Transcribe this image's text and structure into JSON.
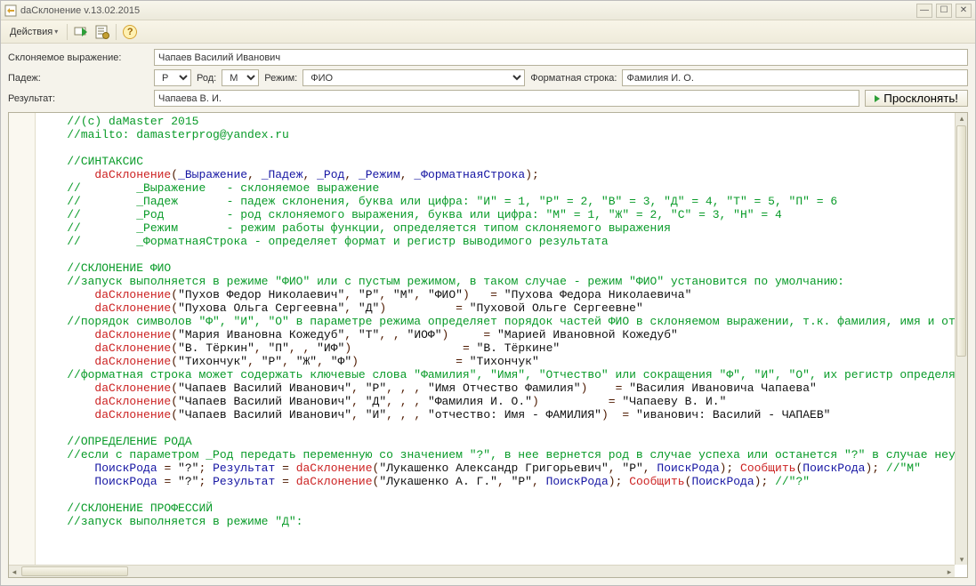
{
  "title": "daСклонение v.13.02.2015",
  "menu": {
    "actions": "Действия"
  },
  "labels": {
    "expr": "Склоняемое выражение:",
    "padezh": "Падеж:",
    "rod": "Род:",
    "rezhim": "Режим:",
    "formatstr": "Форматная строка:",
    "result": "Результат:"
  },
  "values": {
    "expr": "Чапаев Василий Иванович",
    "padezh": "Р",
    "rod": "М",
    "rezhim": "ФИО",
    "formatstr": "Фамилия И. О.",
    "result": "Чапаева В. И."
  },
  "runButton": "Просклонять!",
  "code": [
    {
      "indent": 4,
      "seg": [
        {
          "c": "t-green",
          "t": "//(c) daMaster 2015"
        }
      ]
    },
    {
      "indent": 4,
      "seg": [
        {
          "c": "t-green",
          "t": "//mailto: damasterprog@yandex.ru"
        }
      ]
    },
    {
      "indent": 4,
      "seg": []
    },
    {
      "indent": 4,
      "seg": [
        {
          "c": "t-green",
          "t": "//СИНТАКСИС"
        }
      ]
    },
    {
      "indent": 8,
      "seg": [
        {
          "c": "t-red",
          "t": "daСклонение"
        },
        {
          "c": "t-brown",
          "t": "("
        },
        {
          "c": "t-blue",
          "t": "_Выражение"
        },
        {
          "c": "t-brown",
          "t": ", "
        },
        {
          "c": "t-blue",
          "t": "_Падеж"
        },
        {
          "c": "t-brown",
          "t": ", "
        },
        {
          "c": "t-blue",
          "t": "_Род"
        },
        {
          "c": "t-brown",
          "t": ", "
        },
        {
          "c": "t-blue",
          "t": "_Режим"
        },
        {
          "c": "t-brown",
          "t": ", "
        },
        {
          "c": "t-blue",
          "t": "_ФорматнаяСтрока"
        },
        {
          "c": "t-brown",
          "t": ");"
        }
      ]
    },
    {
      "indent": 4,
      "seg": [
        {
          "c": "t-green",
          "t": "//        _Выражение   - склоняемое выражение"
        }
      ]
    },
    {
      "indent": 4,
      "seg": [
        {
          "c": "t-green",
          "t": "//        _Падеж       - падеж склонения, буква или цифра: \"И\" = 1, \"Р\" = 2, \"В\" = 3, \"Д\" = 4, \"Т\" = 5, \"П\" = 6"
        }
      ]
    },
    {
      "indent": 4,
      "seg": [
        {
          "c": "t-green",
          "t": "//        _Род         - род склоняемого выражения, буква или цифра: \"М\" = 1, \"Ж\" = 2, \"С\" = 3, \"Н\" = 4"
        }
      ]
    },
    {
      "indent": 4,
      "seg": [
        {
          "c": "t-green",
          "t": "//        _Режим       - режим работы функции, определяется типом склоняемого выражения"
        }
      ]
    },
    {
      "indent": 4,
      "seg": [
        {
          "c": "t-green",
          "t": "//        _ФорматнаяСтрока - определяет формат и регистр выводимого результата"
        }
      ]
    },
    {
      "indent": 4,
      "seg": []
    },
    {
      "indent": 4,
      "seg": [
        {
          "c": "t-green",
          "t": "//СКЛОНЕНИЕ ФИО"
        }
      ]
    },
    {
      "indent": 4,
      "seg": [
        {
          "c": "t-green",
          "t": "//запуск выполняется в режиме \"ФИО\" или с пустым режимом, в таком случае - режим \"ФИО\" установится по умолчанию:"
        }
      ]
    },
    {
      "indent": 8,
      "seg": [
        {
          "c": "t-red",
          "t": "daСклонение"
        },
        {
          "c": "t-brown",
          "t": "("
        },
        {
          "c": "t-black",
          "t": "\"Пухов Федор Николаевич\""
        },
        {
          "c": "t-brown",
          "t": ", "
        },
        {
          "c": "t-black",
          "t": "\"Р\""
        },
        {
          "c": "t-brown",
          "t": ", "
        },
        {
          "c": "t-black",
          "t": "\"М\""
        },
        {
          "c": "t-brown",
          "t": ", "
        },
        {
          "c": "t-black",
          "t": "\"ФИО\""
        },
        {
          "c": "t-brown",
          "t": ")   = "
        },
        {
          "c": "t-black",
          "t": "\"Пухова Федора Николаевича\""
        }
      ]
    },
    {
      "indent": 8,
      "seg": [
        {
          "c": "t-red",
          "t": "daСклонение"
        },
        {
          "c": "t-brown",
          "t": "("
        },
        {
          "c": "t-black",
          "t": "\"Пухова Ольга Сергеевна\""
        },
        {
          "c": "t-brown",
          "t": ", "
        },
        {
          "c": "t-black",
          "t": "\"Д\""
        },
        {
          "c": "t-brown",
          "t": ")          = "
        },
        {
          "c": "t-black",
          "t": "\"Пуховой Ольге Сергеевне\""
        }
      ]
    },
    {
      "indent": 4,
      "seg": [
        {
          "c": "t-green",
          "t": "//порядок символов \"Ф\", \"И\", \"О\" в параметре режима определяет порядок частей ФИО в склоняемом выражении, т.к. фамилия, имя и от"
        }
      ]
    },
    {
      "indent": 8,
      "seg": [
        {
          "c": "t-red",
          "t": "daСклонение"
        },
        {
          "c": "t-brown",
          "t": "("
        },
        {
          "c": "t-black",
          "t": "\"Мария Ивановна Кожедуб\""
        },
        {
          "c": "t-brown",
          "t": ", "
        },
        {
          "c": "t-black",
          "t": "\"Т\""
        },
        {
          "c": "t-brown",
          "t": ", , "
        },
        {
          "c": "t-black",
          "t": "\"ИОФ\""
        },
        {
          "c": "t-brown",
          "t": ")     = "
        },
        {
          "c": "t-black",
          "t": "\"Марией Ивановной Кожедуб\""
        }
      ]
    },
    {
      "indent": 8,
      "seg": [
        {
          "c": "t-red",
          "t": "daСклонение"
        },
        {
          "c": "t-brown",
          "t": "("
        },
        {
          "c": "t-black",
          "t": "\"В. Тёркин\""
        },
        {
          "c": "t-brown",
          "t": ", "
        },
        {
          "c": "t-black",
          "t": "\"П\""
        },
        {
          "c": "t-brown",
          "t": ", , "
        },
        {
          "c": "t-black",
          "t": "\"ИФ\""
        },
        {
          "c": "t-brown",
          "t": ")                = "
        },
        {
          "c": "t-black",
          "t": "\"В. Тёркине\""
        }
      ]
    },
    {
      "indent": 8,
      "seg": [
        {
          "c": "t-red",
          "t": "daСклонение"
        },
        {
          "c": "t-brown",
          "t": "("
        },
        {
          "c": "t-black",
          "t": "\"Тихончук\""
        },
        {
          "c": "t-brown",
          "t": ", "
        },
        {
          "c": "t-black",
          "t": "\"Р\""
        },
        {
          "c": "t-brown",
          "t": ", "
        },
        {
          "c": "t-black",
          "t": "\"Ж\""
        },
        {
          "c": "t-brown",
          "t": ", "
        },
        {
          "c": "t-black",
          "t": "\"Ф\""
        },
        {
          "c": "t-brown",
          "t": ")              = "
        },
        {
          "c": "t-black",
          "t": "\"Тихончук\""
        }
      ]
    },
    {
      "indent": 4,
      "seg": [
        {
          "c": "t-green",
          "t": "//форматная строка может содержать ключевые слова \"Фамилия\", \"Имя\", \"Отчество\" или сокращения \"Ф\", \"И\", \"О\", их регистр определя"
        }
      ]
    },
    {
      "indent": 8,
      "seg": [
        {
          "c": "t-red",
          "t": "daСклонение"
        },
        {
          "c": "t-brown",
          "t": "("
        },
        {
          "c": "t-black",
          "t": "\"Чапаев Василий Иванович\""
        },
        {
          "c": "t-brown",
          "t": ", "
        },
        {
          "c": "t-black",
          "t": "\"Р\""
        },
        {
          "c": "t-brown",
          "t": ", , , "
        },
        {
          "c": "t-black",
          "t": "\"Имя Отчество Фамилия\""
        },
        {
          "c": "t-brown",
          "t": ")    = "
        },
        {
          "c": "t-black",
          "t": "\"Василия Ивановича Чапаева\""
        }
      ]
    },
    {
      "indent": 8,
      "seg": [
        {
          "c": "t-red",
          "t": "daСклонение"
        },
        {
          "c": "t-brown",
          "t": "("
        },
        {
          "c": "t-black",
          "t": "\"Чапаев Василий Иванович\""
        },
        {
          "c": "t-brown",
          "t": ", "
        },
        {
          "c": "t-black",
          "t": "\"Д\""
        },
        {
          "c": "t-brown",
          "t": ", , , "
        },
        {
          "c": "t-black",
          "t": "\"Фамилия И. О.\""
        },
        {
          "c": "t-brown",
          "t": ")          = "
        },
        {
          "c": "t-black",
          "t": "\"Чапаеву В. И.\""
        }
      ]
    },
    {
      "indent": 8,
      "seg": [
        {
          "c": "t-red",
          "t": "daСклонение"
        },
        {
          "c": "t-brown",
          "t": "("
        },
        {
          "c": "t-black",
          "t": "\"Чапаев Василий Иванович\""
        },
        {
          "c": "t-brown",
          "t": ", "
        },
        {
          "c": "t-black",
          "t": "\"И\""
        },
        {
          "c": "t-brown",
          "t": ", , , "
        },
        {
          "c": "t-black",
          "t": "\"отчество: Имя - ФАМИЛИЯ\""
        },
        {
          "c": "t-brown",
          "t": ")  = "
        },
        {
          "c": "t-black",
          "t": "\"иванович: Василий - ЧАПАЕВ\""
        }
      ]
    },
    {
      "indent": 4,
      "seg": []
    },
    {
      "indent": 4,
      "seg": [
        {
          "c": "t-green",
          "t": "//ОПРЕДЕЛЕНИЕ РОДА"
        }
      ]
    },
    {
      "indent": 4,
      "seg": [
        {
          "c": "t-green",
          "t": "//если с параметром _Род передать переменную со значением \"?\", в нее вернется род в случае успеха или останется \"?\" в случае неу"
        }
      ]
    },
    {
      "indent": 8,
      "seg": [
        {
          "c": "t-blue",
          "t": "ПоискРода"
        },
        {
          "c": "t-brown",
          "t": " = "
        },
        {
          "c": "t-black",
          "t": "\"?\""
        },
        {
          "c": "t-brown",
          "t": "; "
        },
        {
          "c": "t-blue",
          "t": "Результат"
        },
        {
          "c": "t-brown",
          "t": " = "
        },
        {
          "c": "t-red",
          "t": "daСклонение"
        },
        {
          "c": "t-brown",
          "t": "("
        },
        {
          "c": "t-black",
          "t": "\"Лукашенко Александр Григорьевич\""
        },
        {
          "c": "t-brown",
          "t": ", "
        },
        {
          "c": "t-black",
          "t": "\"Р\""
        },
        {
          "c": "t-brown",
          "t": ", "
        },
        {
          "c": "t-blue",
          "t": "ПоискРода"
        },
        {
          "c": "t-brown",
          "t": "); "
        },
        {
          "c": "t-red",
          "t": "Сообщить"
        },
        {
          "c": "t-brown",
          "t": "("
        },
        {
          "c": "t-blue",
          "t": "ПоискРода"
        },
        {
          "c": "t-brown",
          "t": "); "
        },
        {
          "c": "t-green",
          "t": "//\"М\""
        }
      ]
    },
    {
      "indent": 8,
      "seg": [
        {
          "c": "t-blue",
          "t": "ПоискРода"
        },
        {
          "c": "t-brown",
          "t": " = "
        },
        {
          "c": "t-black",
          "t": "\"?\""
        },
        {
          "c": "t-brown",
          "t": "; "
        },
        {
          "c": "t-blue",
          "t": "Результат"
        },
        {
          "c": "t-brown",
          "t": " = "
        },
        {
          "c": "t-red",
          "t": "daСклонение"
        },
        {
          "c": "t-brown",
          "t": "("
        },
        {
          "c": "t-black",
          "t": "\"Лукашенко А. Г.\""
        },
        {
          "c": "t-brown",
          "t": ", "
        },
        {
          "c": "t-black",
          "t": "\"Р\""
        },
        {
          "c": "t-brown",
          "t": ", "
        },
        {
          "c": "t-blue",
          "t": "ПоискРода"
        },
        {
          "c": "t-brown",
          "t": "); "
        },
        {
          "c": "t-red",
          "t": "Сообщить"
        },
        {
          "c": "t-brown",
          "t": "("
        },
        {
          "c": "t-blue",
          "t": "ПоискРода"
        },
        {
          "c": "t-brown",
          "t": "); "
        },
        {
          "c": "t-green",
          "t": "//\"?\""
        }
      ]
    },
    {
      "indent": 4,
      "seg": []
    },
    {
      "indent": 4,
      "seg": [
        {
          "c": "t-green",
          "t": "//СКЛОНЕНИЕ ПРОФЕССИЙ"
        }
      ]
    },
    {
      "indent": 4,
      "seg": [
        {
          "c": "t-green",
          "t": "//запуск выполняется в режиме \"Д\":"
        }
      ]
    }
  ]
}
